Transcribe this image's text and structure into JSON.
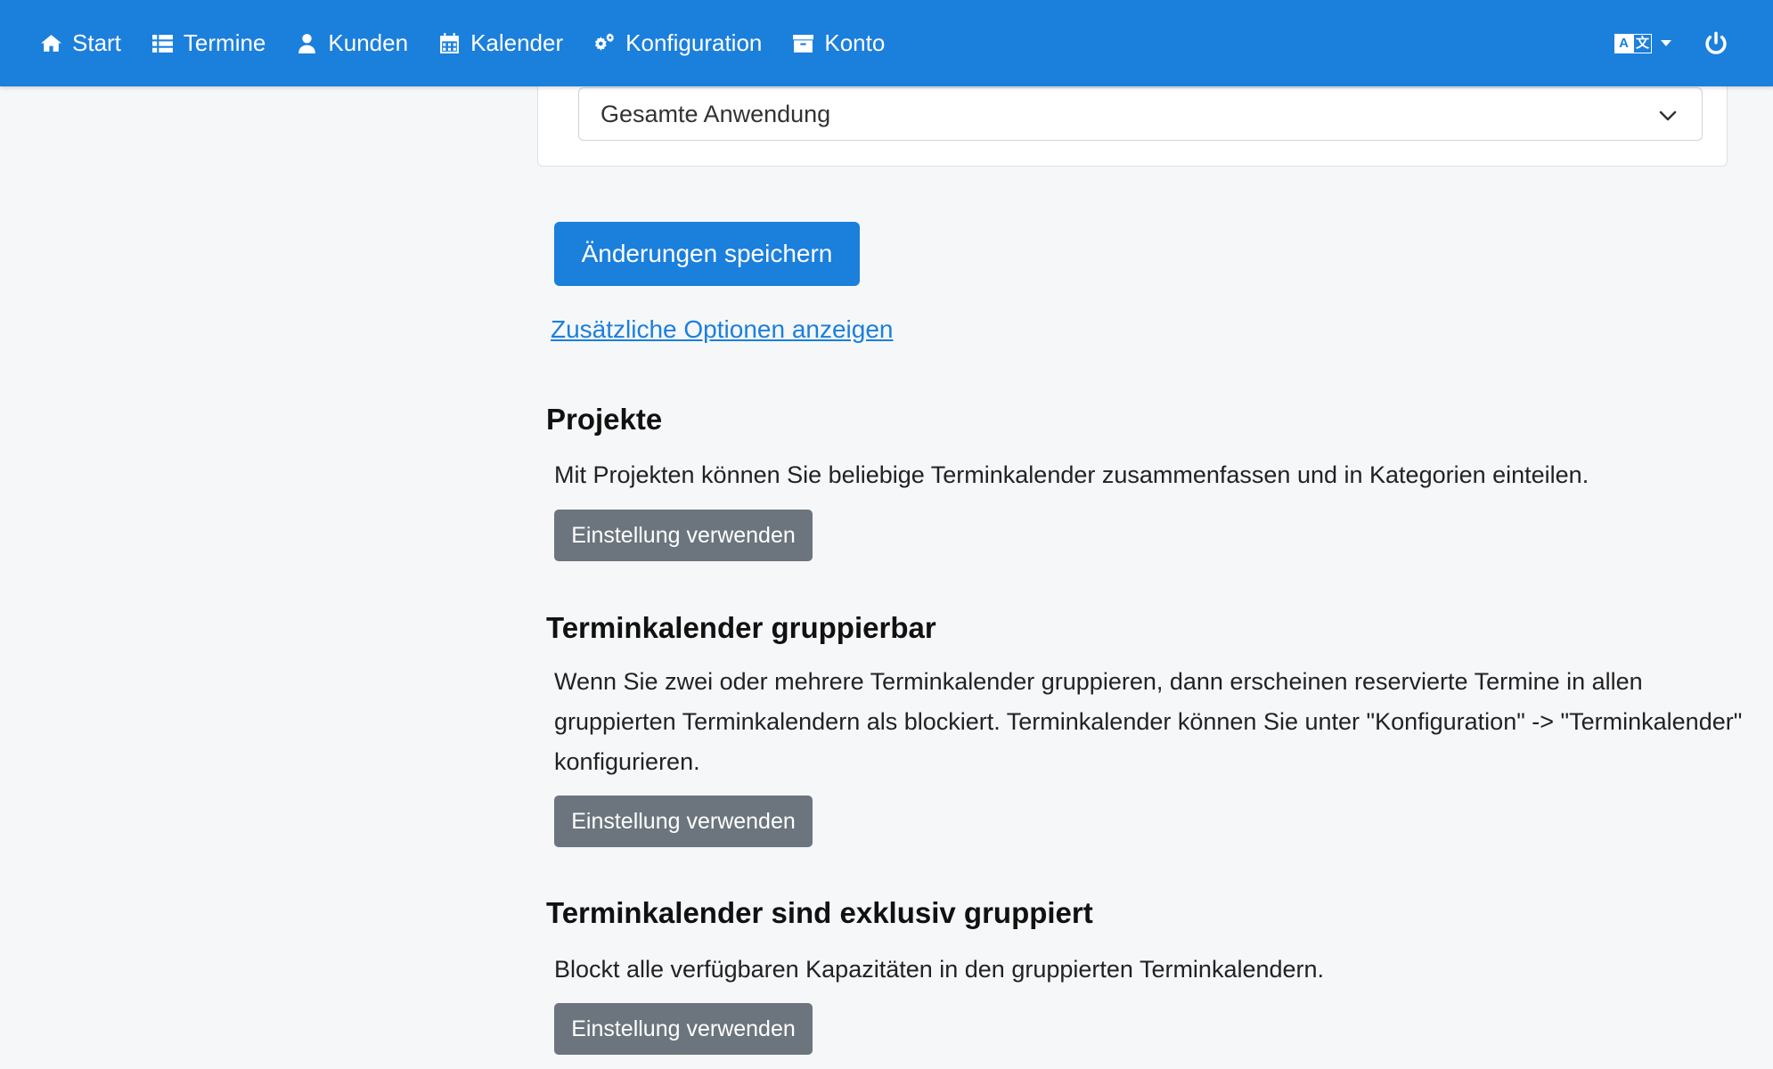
{
  "nav": {
    "items": [
      {
        "label": "Start",
        "icon": "home-icon"
      },
      {
        "label": "Termine",
        "icon": "list-icon"
      },
      {
        "label": "Kunden",
        "icon": "user-icon"
      },
      {
        "label": "Kalender",
        "icon": "calendar-icon"
      },
      {
        "label": "Konfiguration",
        "icon": "cogs-icon"
      },
      {
        "label": "Konto",
        "icon": "archive-icon"
      }
    ],
    "lang_icon": "language-icon",
    "power_icon": "power-icon"
  },
  "scope_select": {
    "value": "Gesamte Anwendung"
  },
  "save_button": "Änderungen speichern",
  "more_options_link": "Zusätzliche Optionen anzeigen",
  "sections": [
    {
      "title": "Projekte",
      "description": "Mit Projekten können Sie beliebige Terminkalender zusammenfassen und in Kategorien einteilen.",
      "button": "Einstellung verwenden"
    },
    {
      "title": "Terminkalender gruppierbar",
      "description": "Wenn Sie zwei oder mehrere Terminkalender gruppieren, dann erscheinen reservierte Termine in allen gruppierten Terminkalendern als blockiert. Terminkalender können Sie unter \"Konfiguration\" -> \"Terminkalender\" konfigurieren.",
      "button": "Einstellung verwenden"
    },
    {
      "title": "Terminkalender sind exklusiv gruppiert",
      "description": "Blockt alle verfügbaren Kapazitäten in den gruppierten Terminkalendern.",
      "button": "Einstellung verwenden"
    }
  ],
  "colors": {
    "primary": "#1b7fdc",
    "secondary": "#6c757d",
    "background": "#f6f7f9"
  }
}
